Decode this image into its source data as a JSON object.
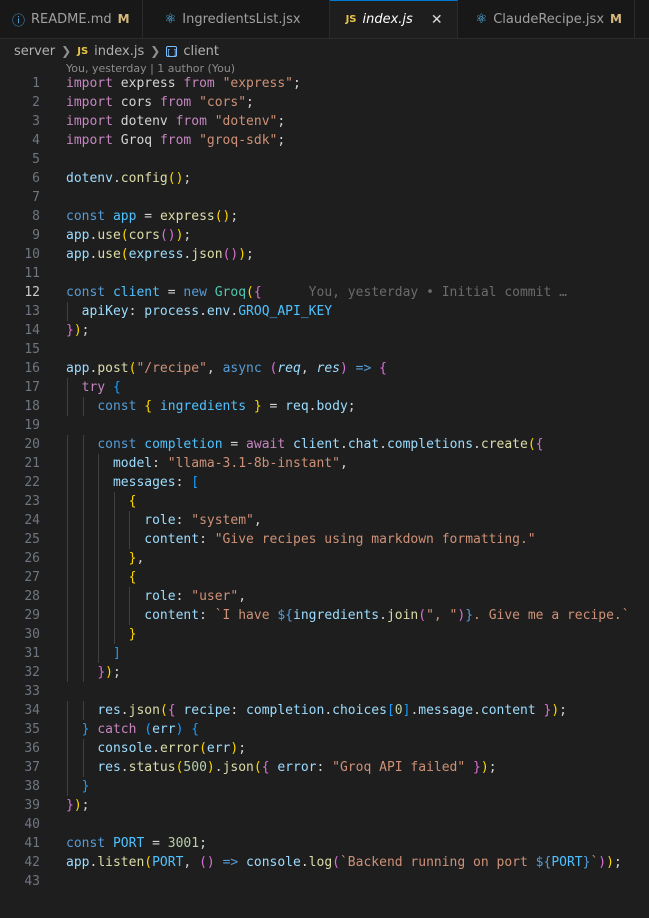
{
  "tabs": [
    {
      "label": "README.md",
      "icon": "info-icon",
      "modified": "M",
      "active": false
    },
    {
      "label": "IngredientsList.jsx",
      "icon": "react-icon",
      "modified": "",
      "active": false
    },
    {
      "label": "index.js",
      "icon": "js-icon",
      "modified": "",
      "active": true,
      "close": "✕"
    },
    {
      "label": "ClaudeRecipe.jsx",
      "icon": "react-icon",
      "modified": "M",
      "active": false
    }
  ],
  "breadcrumb": {
    "folder": "server",
    "file": "index.js",
    "symbol": "client",
    "file_badge": "JS"
  },
  "codelens": "You, yesterday | 1 author (You)",
  "blame": "You, yesterday • Initial commit …",
  "current_line": 12,
  "colors": {
    "background": "#1e1e1e",
    "keyword": "#c586c0",
    "storage": "#569cd6",
    "function": "#dcdcaa",
    "variable": "#9cdcfe",
    "constant": "#4fc1ff",
    "string": "#ce9178",
    "number": "#b5cea8",
    "type": "#4ec9b0",
    "bracket1": "#ffd700",
    "bracket2": "#da70d6",
    "bracket3": "#179fff"
  },
  "lines": [
    [
      [
        "k",
        "import"
      ],
      [
        "p",
        " express "
      ],
      [
        "k",
        "from"
      ],
      [
        "p",
        " "
      ],
      [
        "s",
        "\"express\""
      ],
      [
        "p",
        ";"
      ]
    ],
    [
      [
        "k",
        "import"
      ],
      [
        "p",
        " cors "
      ],
      [
        "k",
        "from"
      ],
      [
        "p",
        " "
      ],
      [
        "s",
        "\"cors\""
      ],
      [
        "p",
        ";"
      ]
    ],
    [
      [
        "k",
        "import"
      ],
      [
        "p",
        " dotenv "
      ],
      [
        "k",
        "from"
      ],
      [
        "p",
        " "
      ],
      [
        "s",
        "\"dotenv\""
      ],
      [
        "p",
        ";"
      ]
    ],
    [
      [
        "k",
        "import"
      ],
      [
        "p",
        " Groq "
      ],
      [
        "k",
        "from"
      ],
      [
        "p",
        " "
      ],
      [
        "s",
        "\"groq-sdk\""
      ],
      [
        "p",
        ";"
      ]
    ],
    [],
    [
      [
        "v",
        "dotenv"
      ],
      [
        "p",
        "."
      ],
      [
        "f",
        "config"
      ],
      [
        "b1",
        "()"
      ],
      [
        "p",
        ";"
      ]
    ],
    [],
    [
      [
        "kb",
        "const"
      ],
      [
        "p",
        " "
      ],
      [
        "c",
        "app"
      ],
      [
        "p",
        " = "
      ],
      [
        "f",
        "express"
      ],
      [
        "b1",
        "()"
      ],
      [
        "p",
        ";"
      ]
    ],
    [
      [
        "v",
        "app"
      ],
      [
        "p",
        "."
      ],
      [
        "f",
        "use"
      ],
      [
        "b1",
        "("
      ],
      [
        "f",
        "cors"
      ],
      [
        "b2",
        "()"
      ],
      [
        "b1",
        ")"
      ],
      [
        "p",
        ";"
      ]
    ],
    [
      [
        "v",
        "app"
      ],
      [
        "p",
        "."
      ],
      [
        "f",
        "use"
      ],
      [
        "b1",
        "("
      ],
      [
        "v",
        "express"
      ],
      [
        "p",
        "."
      ],
      [
        "f",
        "json"
      ],
      [
        "b2",
        "()"
      ],
      [
        "b1",
        ")"
      ],
      [
        "p",
        ";"
      ]
    ],
    [],
    [
      [
        "kb",
        "const"
      ],
      [
        "p",
        " "
      ],
      [
        "c",
        "client"
      ],
      [
        "p",
        " = "
      ],
      [
        "kb",
        "new"
      ],
      [
        "p",
        " "
      ],
      [
        "t",
        "Groq"
      ],
      [
        "b1",
        "("
      ],
      [
        "b2",
        "{"
      ]
    ],
    [
      [
        "p",
        "  "
      ],
      [
        "v",
        "apiKey"
      ],
      [
        "p",
        ": "
      ],
      [
        "v",
        "process"
      ],
      [
        "p",
        "."
      ],
      [
        "v",
        "env"
      ],
      [
        "p",
        "."
      ],
      [
        "c",
        "GROQ_API_KEY"
      ]
    ],
    [
      [
        "b2",
        "}"
      ],
      [
        "b1",
        ")"
      ],
      [
        "p",
        ";"
      ]
    ],
    [],
    [
      [
        "v",
        "app"
      ],
      [
        "p",
        "."
      ],
      [
        "f",
        "post"
      ],
      [
        "b1",
        "("
      ],
      [
        "s",
        "\"/recipe\""
      ],
      [
        "p",
        ", "
      ],
      [
        "kb",
        "async"
      ],
      [
        "p",
        " "
      ],
      [
        "b2",
        "("
      ],
      [
        "v it",
        "req"
      ],
      [
        "p",
        ", "
      ],
      [
        "v it",
        "res"
      ],
      [
        "b2",
        ")"
      ],
      [
        "p",
        " "
      ],
      [
        "kb",
        "=>"
      ],
      [
        "p",
        " "
      ],
      [
        "b2",
        "{"
      ]
    ],
    [
      [
        "p",
        "  "
      ],
      [
        "k",
        "try"
      ],
      [
        "p",
        " "
      ],
      [
        "b3",
        "{"
      ]
    ],
    [
      [
        "p",
        "    "
      ],
      [
        "kb",
        "const"
      ],
      [
        "p",
        " "
      ],
      [
        "b1",
        "{"
      ],
      [
        "p",
        " "
      ],
      [
        "c",
        "ingredients"
      ],
      [
        "p",
        " "
      ],
      [
        "b1",
        "}"
      ],
      [
        "p",
        " = "
      ],
      [
        "v",
        "req"
      ],
      [
        "p",
        "."
      ],
      [
        "v",
        "body"
      ],
      [
        "p",
        ";"
      ]
    ],
    [],
    [
      [
        "p",
        "    "
      ],
      [
        "kb",
        "const"
      ],
      [
        "p",
        " "
      ],
      [
        "c",
        "completion"
      ],
      [
        "p",
        " = "
      ],
      [
        "k",
        "await"
      ],
      [
        "p",
        " "
      ],
      [
        "v",
        "client"
      ],
      [
        "p",
        "."
      ],
      [
        "v",
        "chat"
      ],
      [
        "p",
        "."
      ],
      [
        "v",
        "completions"
      ],
      [
        "p",
        "."
      ],
      [
        "f",
        "create"
      ],
      [
        "b1",
        "("
      ],
      [
        "b2",
        "{"
      ]
    ],
    [
      [
        "p",
        "      "
      ],
      [
        "v",
        "model"
      ],
      [
        "p",
        ": "
      ],
      [
        "s",
        "\"llama-3.1-8b-instant\""
      ],
      [
        "p",
        ","
      ]
    ],
    [
      [
        "p",
        "      "
      ],
      [
        "v",
        "messages"
      ],
      [
        "p",
        ": "
      ],
      [
        "b3",
        "["
      ]
    ],
    [
      [
        "p",
        "        "
      ],
      [
        "b1",
        "{"
      ]
    ],
    [
      [
        "p",
        "          "
      ],
      [
        "v",
        "role"
      ],
      [
        "p",
        ": "
      ],
      [
        "s",
        "\"system\""
      ],
      [
        "p",
        ","
      ]
    ],
    [
      [
        "p",
        "          "
      ],
      [
        "v",
        "content"
      ],
      [
        "p",
        ": "
      ],
      [
        "s",
        "\"Give recipes using markdown formatting.\""
      ]
    ],
    [
      [
        "p",
        "        "
      ],
      [
        "b1",
        "}"
      ],
      [
        "p",
        ","
      ]
    ],
    [
      [
        "p",
        "        "
      ],
      [
        "b1",
        "{"
      ]
    ],
    [
      [
        "p",
        "          "
      ],
      [
        "v",
        "role"
      ],
      [
        "p",
        ": "
      ],
      [
        "s",
        "\"user\""
      ],
      [
        "p",
        ","
      ]
    ],
    [
      [
        "p",
        "          "
      ],
      [
        "v",
        "content"
      ],
      [
        "p",
        ": "
      ],
      [
        "s",
        "`I have "
      ],
      [
        "kb",
        "${"
      ],
      [
        "v",
        "ingredients"
      ],
      [
        "p",
        "."
      ],
      [
        "f",
        "join"
      ],
      [
        "b2",
        "("
      ],
      [
        "s",
        "\", \""
      ],
      [
        "b2",
        ")"
      ],
      [
        "kb",
        "}"
      ],
      [
        "s",
        ". Give me a recipe.`"
      ]
    ],
    [
      [
        "p",
        "        "
      ],
      [
        "b1",
        "}"
      ]
    ],
    [
      [
        "p",
        "      "
      ],
      [
        "b3",
        "]"
      ]
    ],
    [
      [
        "p",
        "    "
      ],
      [
        "b2",
        "}"
      ],
      [
        "b1",
        ")"
      ],
      [
        "p",
        ";"
      ]
    ],
    [],
    [
      [
        "p",
        "    "
      ],
      [
        "v",
        "res"
      ],
      [
        "p",
        "."
      ],
      [
        "f",
        "json"
      ],
      [
        "b1",
        "("
      ],
      [
        "b2",
        "{"
      ],
      [
        "p",
        " "
      ],
      [
        "v",
        "recipe"
      ],
      [
        "p",
        ": "
      ],
      [
        "v",
        "completion"
      ],
      [
        "p",
        "."
      ],
      [
        "v",
        "choices"
      ],
      [
        "b3",
        "["
      ],
      [
        "n",
        "0"
      ],
      [
        "b3",
        "]"
      ],
      [
        "p",
        "."
      ],
      [
        "v",
        "message"
      ],
      [
        "p",
        "."
      ],
      [
        "v",
        "content"
      ],
      [
        "p",
        " "
      ],
      [
        "b2",
        "}"
      ],
      [
        "b1",
        ")"
      ],
      [
        "p",
        ";"
      ]
    ],
    [
      [
        "p",
        "  "
      ],
      [
        "b3",
        "}"
      ],
      [
        "p",
        " "
      ],
      [
        "k",
        "catch"
      ],
      [
        "p",
        " "
      ],
      [
        "b3",
        "("
      ],
      [
        "v",
        "err"
      ],
      [
        "b3",
        ")"
      ],
      [
        "p",
        " "
      ],
      [
        "b3",
        "{"
      ]
    ],
    [
      [
        "p",
        "    "
      ],
      [
        "v",
        "console"
      ],
      [
        "p",
        "."
      ],
      [
        "f",
        "error"
      ],
      [
        "b1",
        "("
      ],
      [
        "v",
        "err"
      ],
      [
        "b1",
        ")"
      ],
      [
        "p",
        ";"
      ]
    ],
    [
      [
        "p",
        "    "
      ],
      [
        "v",
        "res"
      ],
      [
        "p",
        "."
      ],
      [
        "f",
        "status"
      ],
      [
        "b1",
        "("
      ],
      [
        "n",
        "500"
      ],
      [
        "b1",
        ")"
      ],
      [
        "p",
        "."
      ],
      [
        "f",
        "json"
      ],
      [
        "b1",
        "("
      ],
      [
        "b2",
        "{"
      ],
      [
        "p",
        " "
      ],
      [
        "v",
        "error"
      ],
      [
        "p",
        ": "
      ],
      [
        "s",
        "\"Groq API failed\""
      ],
      [
        "p",
        " "
      ],
      [
        "b2",
        "}"
      ],
      [
        "b1",
        ")"
      ],
      [
        "p",
        ";"
      ]
    ],
    [
      [
        "p",
        "  "
      ],
      [
        "b3",
        "}"
      ]
    ],
    [
      [
        "b2",
        "}"
      ],
      [
        "b1",
        ")"
      ],
      [
        "p",
        ";"
      ]
    ],
    [],
    [
      [
        "kb",
        "const"
      ],
      [
        "p",
        " "
      ],
      [
        "c",
        "PORT"
      ],
      [
        "p",
        " = "
      ],
      [
        "n",
        "3001"
      ],
      [
        "p",
        ";"
      ]
    ],
    [
      [
        "v",
        "app"
      ],
      [
        "p",
        "."
      ],
      [
        "f",
        "listen"
      ],
      [
        "b1",
        "("
      ],
      [
        "c",
        "PORT"
      ],
      [
        "p",
        ", "
      ],
      [
        "b2",
        "()"
      ],
      [
        "p",
        " "
      ],
      [
        "kb",
        "=>"
      ],
      [
        "p",
        " "
      ],
      [
        "v",
        "console"
      ],
      [
        "p",
        "."
      ],
      [
        "f",
        "log"
      ],
      [
        "b2",
        "("
      ],
      [
        "s",
        "`Backend running on port "
      ],
      [
        "kb",
        "${"
      ],
      [
        "c",
        "PORT"
      ],
      [
        "kb",
        "}"
      ],
      [
        "s",
        "`"
      ],
      [
        "b2",
        ")"
      ],
      [
        "b1",
        ")"
      ],
      [
        "p",
        ";"
      ]
    ],
    []
  ]
}
